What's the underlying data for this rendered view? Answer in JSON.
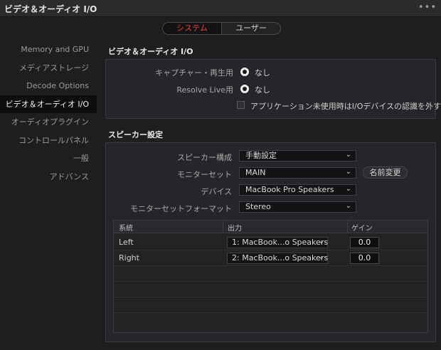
{
  "window": {
    "title": "ビデオ＆オーディオ I/O",
    "more_icon": "more-dots-icon"
  },
  "segment": {
    "system": "システム",
    "user": "ユーザー",
    "active": "system",
    "active_color": "#e6413a"
  },
  "sidebar": {
    "items": [
      {
        "label": "Memory and GPU"
      },
      {
        "label": "メディアストレージ"
      },
      {
        "label": "Decode Options"
      },
      {
        "label": "ビデオ＆オーディオ I/O",
        "active": true
      },
      {
        "label": "オーディオプラグイン"
      },
      {
        "label": "コントロールパネル"
      },
      {
        "label": "一般"
      },
      {
        "label": "アドバンス"
      }
    ]
  },
  "video_audio_io": {
    "section_title": "ビデオ＆オーディオ I/O",
    "capture_label": "キャプチャー・再生用",
    "capture_value": "なし",
    "resolve_live_label": "Resolve Live用",
    "resolve_live_value": "なし",
    "disable_io_label": "アプリケーション未使用時はI/Oデバイスの認識を外す"
  },
  "speaker": {
    "section_title": "スピーカー設定",
    "config_label": "スピーカー構成",
    "config_value": "手動設定",
    "monitor_set_label": "モニターセット",
    "monitor_set_value": "MAIN",
    "rename_button": "名前変更",
    "device_label": "デバイス",
    "device_value": "MacBook Pro Speakers",
    "format_label": "モニターセットフォーマット",
    "format_value": "Stereo",
    "table": {
      "headers": [
        "系統",
        "出力",
        "ゲイン"
      ],
      "rows": [
        {
          "channel": "Left",
          "output": "1: MacBook...o Speakers",
          "gain": "0.0"
        },
        {
          "channel": "Right",
          "output": "2: MacBook...o Speakers",
          "gain": "0.0"
        }
      ]
    }
  }
}
